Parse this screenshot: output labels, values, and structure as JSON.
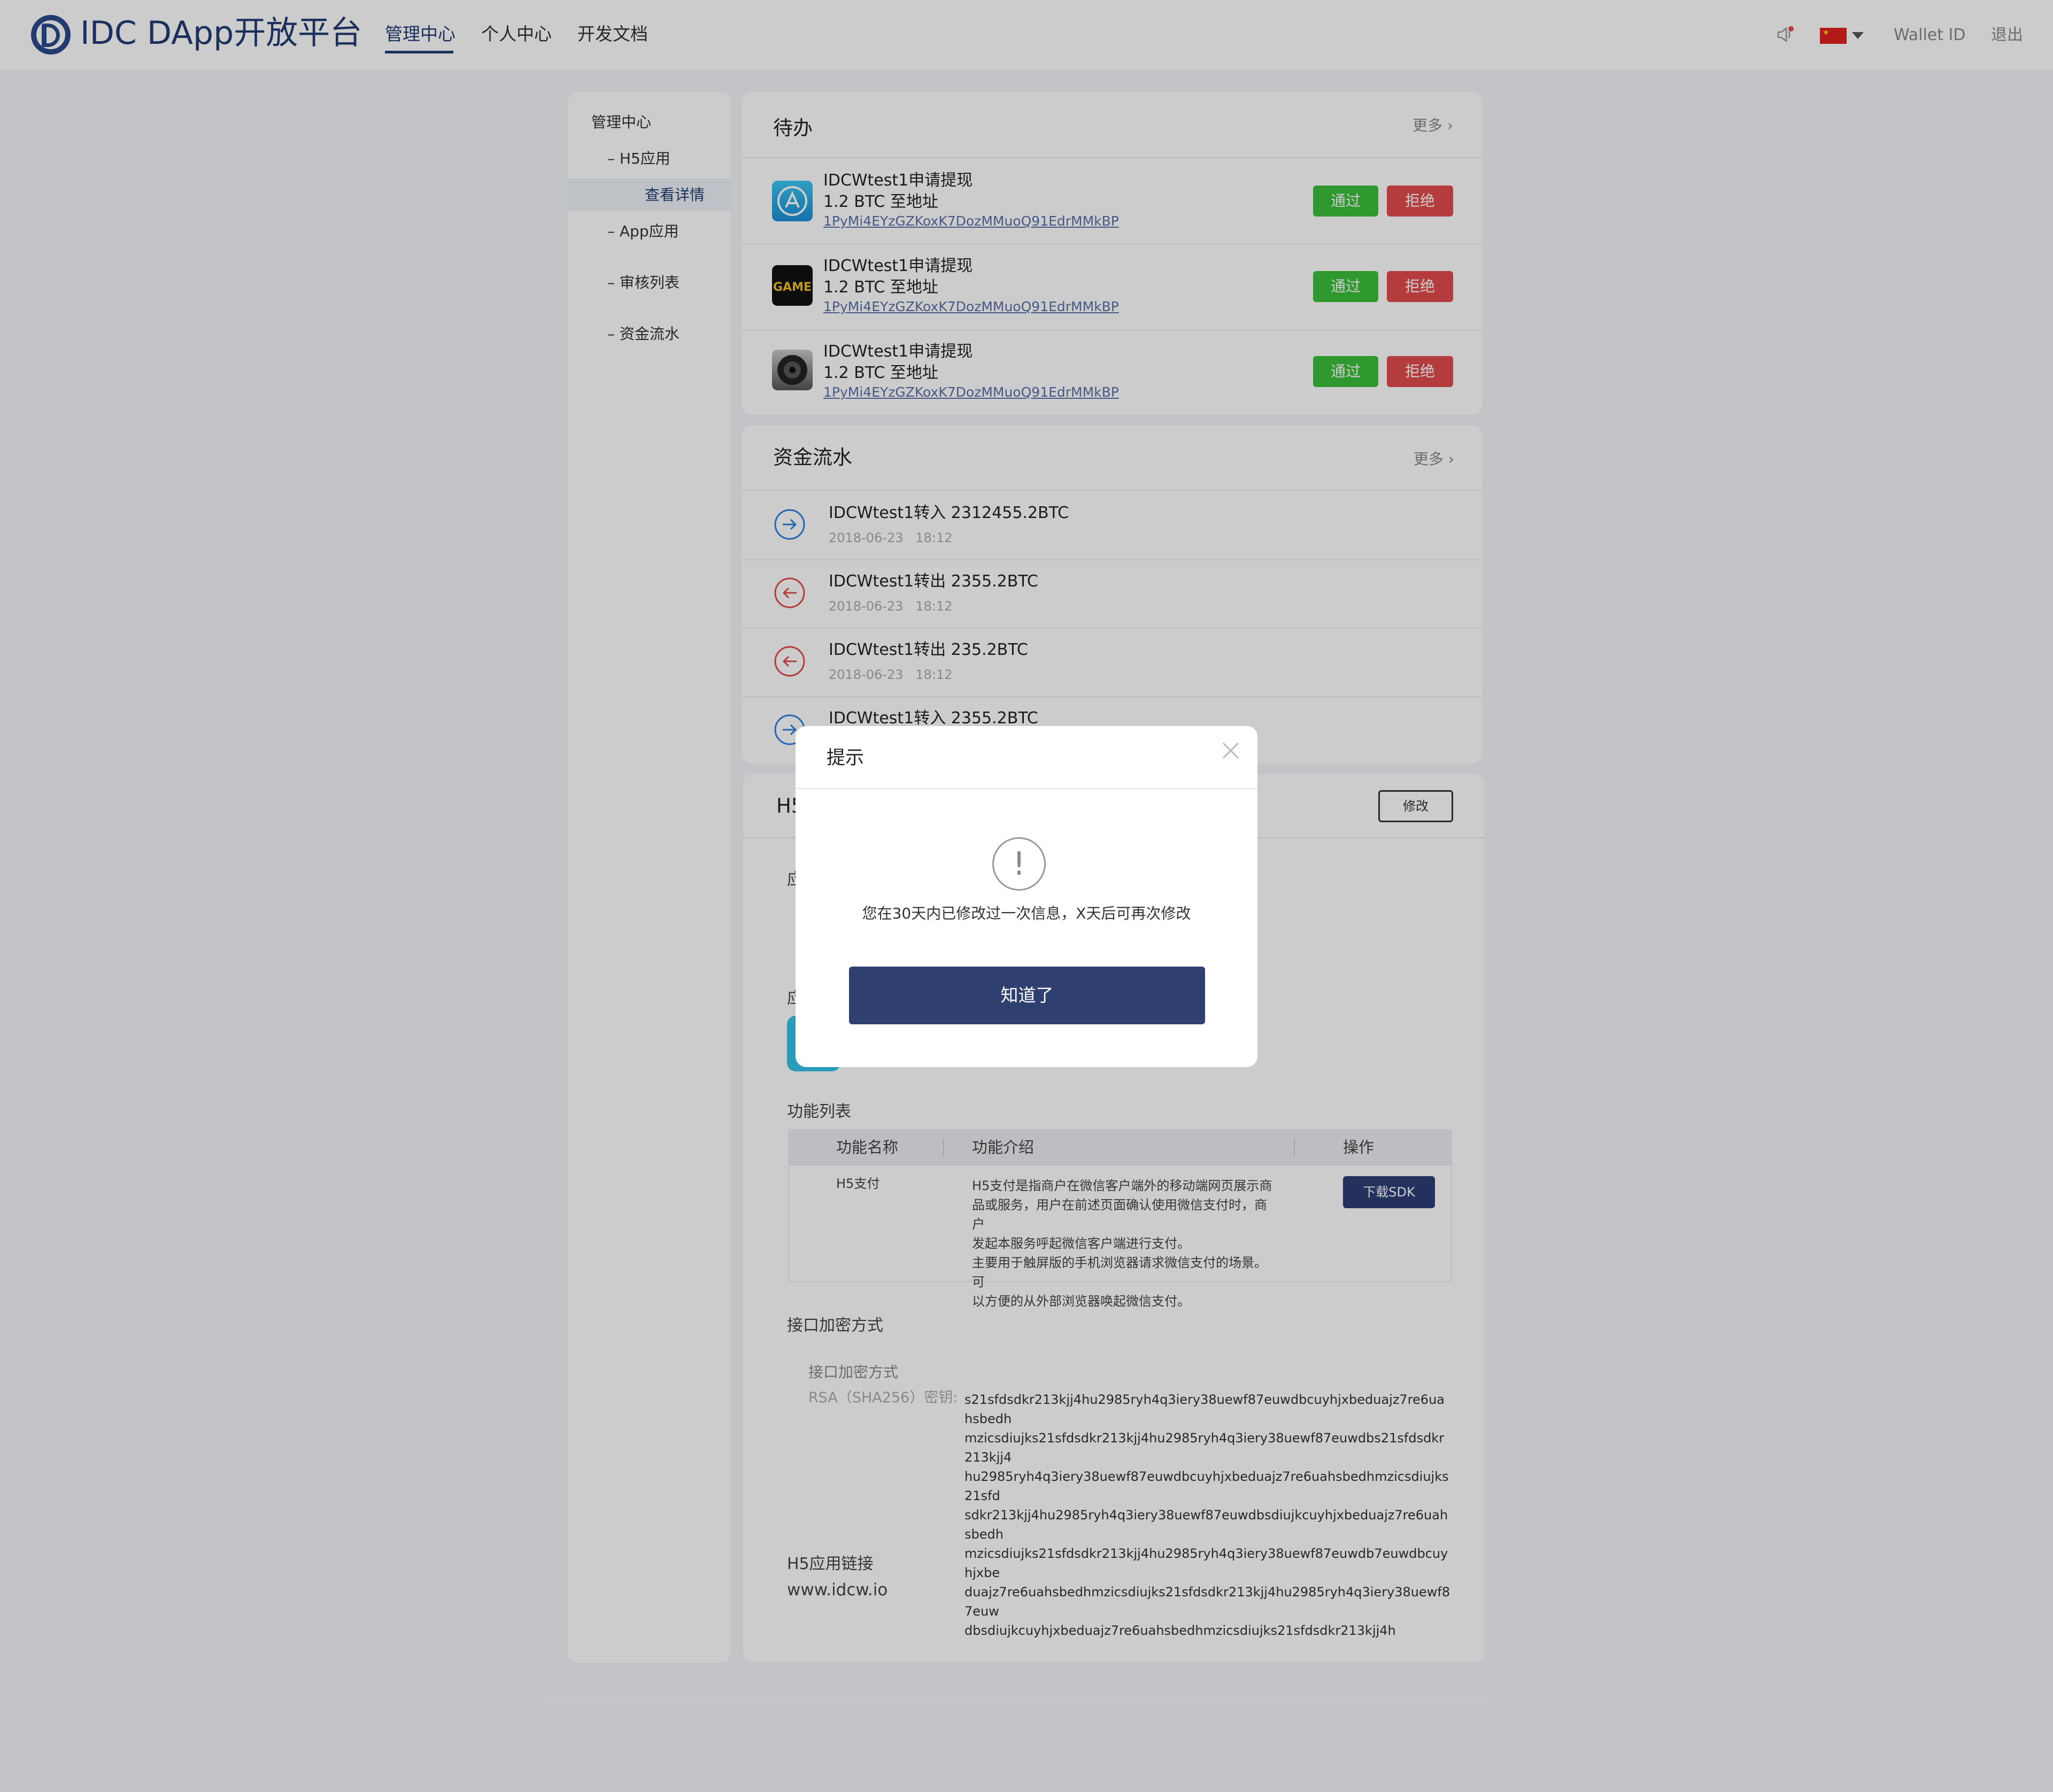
{
  "header": {
    "app_title": "IDC DApp开放平台",
    "nav": [
      "管理中心",
      "个人中心",
      "开发文档"
    ],
    "wallet_label": "Wallet ID",
    "logout_label": "退出",
    "language_flag": "cn-flag-icon",
    "notification_icon": "speaker-icon"
  },
  "sidebar": {
    "root": "管理中心",
    "items": [
      {
        "label": "H5应用"
      },
      {
        "label": "查看详情"
      },
      {
        "label": "App应用"
      },
      {
        "label": "审核列表"
      },
      {
        "label": "资金流水"
      }
    ]
  },
  "todo": {
    "title": "待办",
    "more_label": "更多",
    "items": [
      {
        "title": "IDCWtest1申请提现",
        "amount": "1.2 BTC 至地址",
        "address": "1PyMi4EYzGZKoxK7DozMMuoQ91EdrMMkBP",
        "approve": "通过",
        "reject": "拒绝",
        "icon": "app-store-icon"
      },
      {
        "title": "IDCWtest1申请提现",
        "amount": "1.2 BTC 至地址",
        "address": "1PyMi4EYzGZKoxK7DozMMuoQ91EdrMMkBP",
        "approve": "通过",
        "reject": "拒绝",
        "icon": "game-icon"
      },
      {
        "title": "IDCWtest1申请提现",
        "amount": "1.2 BTC 至地址",
        "address": "1PyMi4EYzGZKoxK7DozMMuoQ91EdrMMkBP",
        "approve": "通过",
        "reject": "拒绝",
        "icon": "speaker-app-icon"
      }
    ]
  },
  "funds": {
    "title": "资金流水",
    "more_label": "更多",
    "items": [
      {
        "text": "IDCWtest1转入 2312455.2BTC",
        "date": "2018-06-23",
        "time": "18:12",
        "direction": "in"
      },
      {
        "text": "IDCWtest1转出 2355.2BTC",
        "date": "2018-06-23",
        "time": "18:12",
        "direction": "out"
      },
      {
        "text": "IDCWtest1转出 235.2BTC",
        "date": "2018-06-23",
        "time": "18:12",
        "direction": "out"
      },
      {
        "text": "IDCWtest1转入 2355.2BTC",
        "date": "",
        "time": "",
        "direction": "in"
      }
    ],
    "colors": {
      "in": "#2f7fe0",
      "out": "#e24b4b"
    }
  },
  "detail": {
    "title_fragment": "H5",
    "edit_label": "修改",
    "field_fragment_1": "应",
    "field_fragment_2": "应",
    "features": {
      "label": "功能列表",
      "columns": [
        "功能名称",
        "功能介绍",
        "操作"
      ],
      "rows": [
        {
          "name": "H5支付",
          "desc_lines": [
            "H5支付是指商户在微信客户端外的移动端网页展示商",
            "品或服务，用户在前述页面确认使用微信支付时，商户",
            "发起本服务呼起微信客户端进行支付。",
            "主要用于触屏版的手机浏览器请求微信支付的场景。可",
            "以方便的从外部浏览器唤起微信支付。"
          ],
          "action": "下载SDK"
        }
      ]
    },
    "encryption": {
      "section_label": "接口加密方式",
      "method_label": "接口加密方式",
      "key_label": "RSA（SHA256）密钥:",
      "key_lines": [
        "s21sfdsdkr213kjj4hu2985ryh4q3iery38uewf87euwdbcuyhjxbeduajz7re6uahsbedh",
        "mzicsdiujks21sfdsdkr213kjj4hu2985ryh4q3iery38uewf87euwdbs21sfdsdkr213kjj4",
        "hu2985ryh4q3iery38uewf87euwdbcuyhjxbeduajz7re6uahsbedhmzicsdiujks21sfd",
        "sdkr213kjj4hu2985ryh4q3iery38uewf87euwdbsdiujkcuyhjxbeduajz7re6uahsbedh",
        "mzicsdiujks21sfdsdkr213kjj4hu2985ryh4q3iery38uewf87euwdb7euwdbcuyhjxbe",
        "duajz7re6uahsbedhmzicsdiujks21sfdsdkr213kjj4hu2985ryh4q3iery38uewf87euw",
        "dbsdiujkcuyhjxbeduajz7re6uahsbedhmzicsdiujks21sfdsdkr213kjj4h"
      ]
    },
    "link": {
      "label": "H5应用链接",
      "value": "www.idcw.io"
    }
  },
  "modal": {
    "title": "提示",
    "message": "您在30天内已修改过一次信息，X天后可再次修改",
    "confirm_label": "知道了",
    "icon": "exclamation-icon"
  },
  "colors": {
    "brand": "#223c74",
    "approve": "#3bbf3b",
    "reject": "#e24b4b",
    "modal_button": "#2f3f70"
  }
}
